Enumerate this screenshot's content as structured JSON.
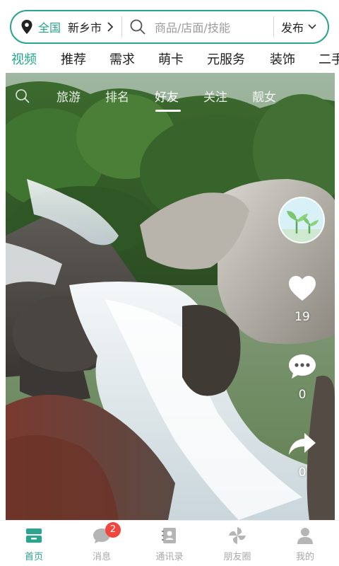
{
  "search": {
    "scope": "全国",
    "city": "新乡市",
    "placeholder": "商品/店面/技能",
    "publish_label": "发布"
  },
  "categories": [
    "视频",
    "推荐",
    "需求",
    "萌卡",
    "元服务",
    "装饰",
    "二手"
  ],
  "active_category": "视频",
  "video": {
    "sub_tabs": [
      "旅游",
      "排名",
      "好友",
      "关注",
      "靓女"
    ],
    "active_sub_tab": "好友",
    "likes": "19",
    "comments": "0",
    "shares": "0"
  },
  "bottom_nav": {
    "items": [
      {
        "label": "首页",
        "icon": "home-icon"
      },
      {
        "label": "消息",
        "icon": "message-icon",
        "badge": "2"
      },
      {
        "label": "通讯录",
        "icon": "contacts-icon"
      },
      {
        "label": "朋友圈",
        "icon": "moments-icon"
      },
      {
        "label": "我的",
        "icon": "profile-icon"
      }
    ],
    "active": "首页"
  },
  "colors": {
    "accent": "#2aa58f",
    "badge": "#f2453d",
    "inactive": "#a8a8a8"
  }
}
